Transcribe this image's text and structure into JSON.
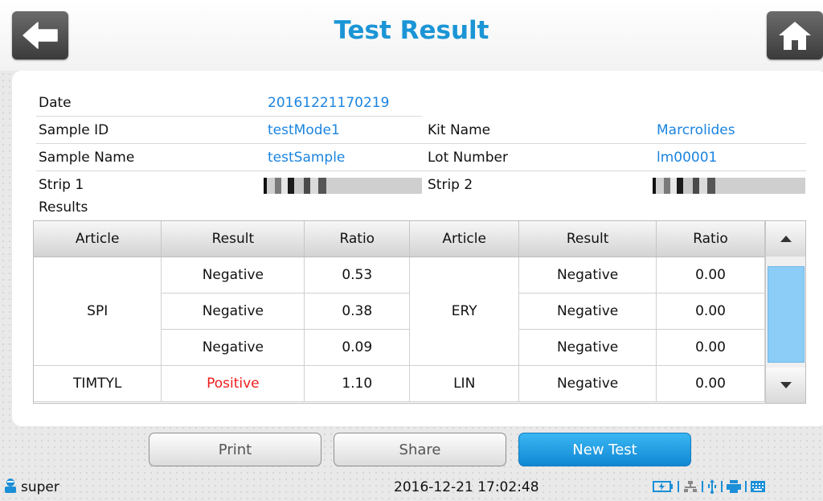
{
  "header": {
    "title": "Test Result"
  },
  "info": {
    "date_label": "Date",
    "date_value": "20161221170219",
    "sample_id_label": "Sample ID",
    "sample_id_value": "testMode1",
    "kit_name_label": "Kit Name",
    "kit_name_value": "Marcrolides",
    "sample_name_label": "Sample Name",
    "sample_name_value": "testSample",
    "lot_number_label": "Lot Number",
    "lot_number_value": "lm00001",
    "strip1_label": "Strip 1",
    "strip2_label": "Strip 2",
    "results_label": "Results"
  },
  "table": {
    "columns": [
      "Article",
      "Result",
      "Ratio",
      "Article",
      "Result",
      "Ratio"
    ],
    "groups": [
      {
        "article_left": "SPI",
        "article_right": "ERY",
        "rows": [
          {
            "result_left": "Negative",
            "ratio_left": "0.53",
            "result_right": "Negative",
            "ratio_right": "0.00"
          },
          {
            "result_left": "Negative",
            "ratio_left": "0.38",
            "result_right": "Negative",
            "ratio_right": "0.00"
          },
          {
            "result_left": "Negative",
            "ratio_left": "0.09",
            "result_right": "Negative",
            "ratio_right": "0.00"
          }
        ]
      },
      {
        "article_left": "TIMTYL",
        "article_right": "LIN",
        "rows": [
          {
            "result_left": "Positive",
            "ratio_left": "1.10",
            "result_right": "Negative",
            "ratio_right": "0.00"
          }
        ]
      }
    ]
  },
  "buttons": {
    "print": "Print",
    "share": "Share",
    "new_test": "New Test"
  },
  "status": {
    "user": "super",
    "datetime": "2016-12-21 17:02:48"
  },
  "icons": {
    "back": "arrow-left-icon",
    "home": "home-icon",
    "user": "user-icon",
    "battery": "battery-charging-icon",
    "network": "network-icon",
    "usb": "usb-icon",
    "printer": "printer-icon",
    "keyboard": "keyboard-icon",
    "scroll_up": "triangle-up-icon",
    "scroll_down": "triangle-down-icon"
  },
  "colors": {
    "accent": "#1b95d6",
    "value": "#1b84e0",
    "positive": "#ee1c1c",
    "primary_button": "#1a9ae0"
  }
}
